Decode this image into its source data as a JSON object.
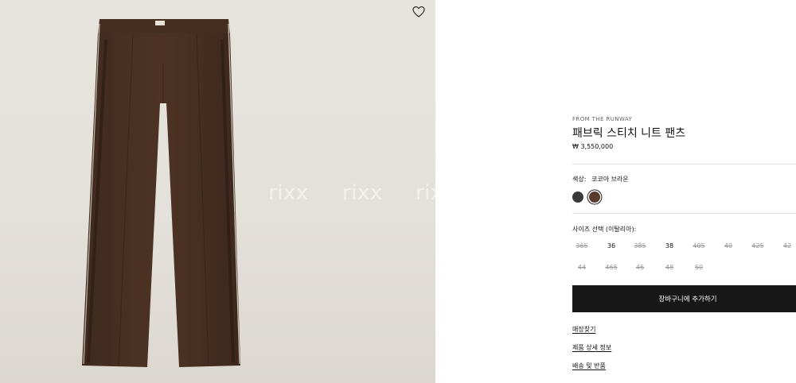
{
  "gallery": {
    "watermarks": [
      "rixx",
      "rixx",
      "rixx"
    ],
    "wishlist_icon": "heart-outline-icon"
  },
  "product": {
    "eyebrow": "FROM THE RUNWAY",
    "title": "패브릭 스티치 니트 팬츠",
    "price": "₩ 3,550,000",
    "color_label": "색상:",
    "color_value": "코코아 브라운",
    "swatches": [
      {
        "name": "charcoal",
        "color": "#3a3a3a",
        "selected": false
      },
      {
        "name": "cocoa-brown",
        "color": "#5a3a2a",
        "selected": true
      }
    ],
    "size_label": "사이즈 선택 (이탈리아):",
    "sizes_row1": [
      {
        "label": "365",
        "available": false
      },
      {
        "label": "36",
        "available": true
      },
      {
        "label": "385",
        "available": false
      },
      {
        "label": "38",
        "available": true
      },
      {
        "label": "405",
        "available": false
      },
      {
        "label": "40",
        "available": false
      },
      {
        "label": "425",
        "available": false
      },
      {
        "label": "42",
        "available": false
      }
    ],
    "sizes_row2": [
      {
        "label": "44",
        "available": false
      },
      {
        "label": "465",
        "available": false
      },
      {
        "label": "46",
        "available": false
      },
      {
        "label": "48",
        "available": false
      },
      {
        "label": "50",
        "available": false
      }
    ],
    "add_to_cart": "장바구니에 추가하기",
    "links": [
      "매장찾기",
      "제품 상세 정보",
      "배송 및 반품"
    ]
  }
}
